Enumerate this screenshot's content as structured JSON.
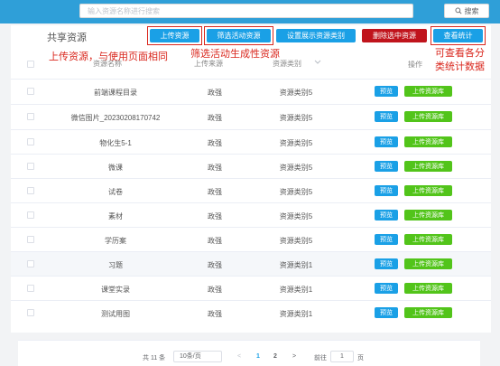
{
  "search": {
    "placeholder": "输入资源名称进行搜索",
    "button_label": "搜索"
  },
  "panel": {
    "title": "共享资源"
  },
  "toolbar": {
    "upload_label": "上传资源",
    "filter_label": "筛选活动资源",
    "set_category_label": "设置展示资源类别",
    "delete_label": "删除选中资源",
    "stats_label": "查看统计"
  },
  "annotations": {
    "upload_note": "上传资源，与使用页面相同",
    "filter_note": "筛选活动生成性资源",
    "stats_note_line1": "可查看各分",
    "stats_note_line2": "类统计数据"
  },
  "table": {
    "headers": {
      "name": "资源名称",
      "source": "上传来源",
      "type": "资源类别",
      "action": "操作"
    },
    "preview_label": "预览",
    "upload_lib_label": "上传资源库",
    "rows": [
      {
        "name": "前端课程目录",
        "source": "政强",
        "type": "资源类别5"
      },
      {
        "name": "微信图片_20230208170742",
        "source": "政强",
        "type": "资源类别5"
      },
      {
        "name": "物化生5-1",
        "source": "政强",
        "type": "资源类别5"
      },
      {
        "name": "微课",
        "source": "政强",
        "type": "资源类别5"
      },
      {
        "name": "试卷",
        "source": "政强",
        "type": "资源类别5"
      },
      {
        "name": "素材",
        "source": "政强",
        "type": "资源类别5"
      },
      {
        "name": "学历案",
        "source": "政强",
        "type": "资源类别5"
      },
      {
        "name": "习题",
        "source": "政强",
        "type": "资源类别1"
      },
      {
        "name": "课堂实录",
        "source": "政强",
        "type": "资源类别1"
      },
      {
        "name": "测试用图",
        "source": "政强",
        "type": "资源类别1"
      }
    ]
  },
  "pagination": {
    "total": "共 11 条",
    "page_size": "10条/页",
    "prev": "<",
    "page1": "1",
    "page2": "2",
    "next": ">",
    "goto_label": "前往",
    "goto_value": "1",
    "page_unit": "页"
  },
  "colors": {
    "topbar": "#2f9fd8",
    "primary": "#1aa0e6",
    "danger": "#c0141c",
    "success": "#52c41a",
    "annotation": "#d9261c"
  }
}
